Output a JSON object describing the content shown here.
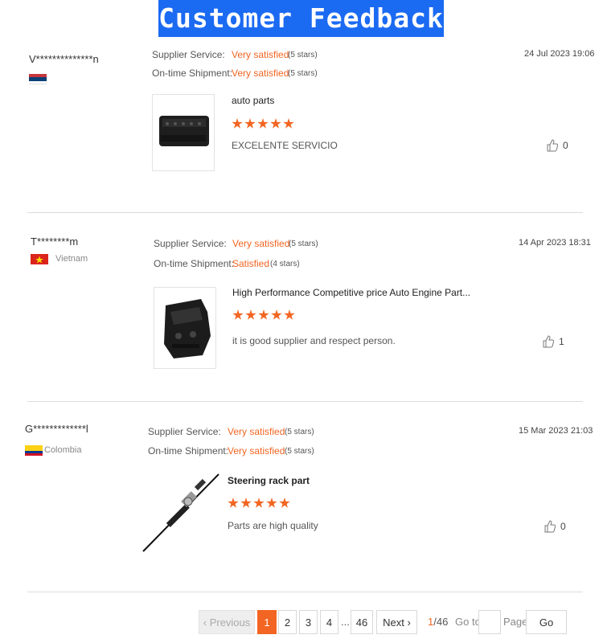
{
  "header": {
    "title": "Customer Feedback"
  },
  "labels": {
    "supplier_service": "Supplier Service:",
    "ontime_shipment": "On-time Shipment:"
  },
  "reviews": [
    {
      "user": "V**************n",
      "country": "",
      "flag": [
        "#c6363c",
        "#0c4076",
        "#ffffff"
      ],
      "supplier_rating": "Very satisfied",
      "supplier_stars": "(5 stars)",
      "shipment_rating": "Very satisfied",
      "shipment_stars": "(5 stars)",
      "date": "24 Jul 2023 19:06",
      "product": "auto parts",
      "product_stars": 5,
      "comment": "EXCELENTE SERVICIO",
      "likes": "0"
    },
    {
      "user": "T********m",
      "country": "Vietnam",
      "flag": [
        "#da251d",
        "#da251d",
        "#da251d"
      ],
      "supplier_rating": "Very satisfied",
      "supplier_stars": "(5 stars)",
      "shipment_rating": "Satisfied",
      "shipment_stars": "(4 stars)",
      "date": "14 Apr 2023 18:31",
      "product": "High Performance Competitive price Auto Engine Part...",
      "product_stars": 5,
      "comment": "it is good supplier and respect person.",
      "likes": "1"
    },
    {
      "user": "G*************l",
      "country": "Colombia",
      "flag": [
        "#fcd116",
        "#003893",
        "#ce1126"
      ],
      "supplier_rating": "Very satisfied",
      "supplier_stars": "(5 stars)",
      "shipment_rating": "Very satisfied",
      "shipment_stars": "(5 stars)",
      "date": "15 Mar 2023 21:03",
      "product": "Steering rack part",
      "product_stars": 5,
      "comment": "Parts are high quality",
      "likes": "0"
    }
  ],
  "pagination": {
    "previous": "Previous",
    "pages": [
      "1",
      "2",
      "3",
      "4",
      "...",
      "46"
    ],
    "next": "Next",
    "current": "1",
    "total": "/46",
    "goto_label": "Go to",
    "page_label": "Page",
    "go_button": "Go"
  },
  "colors": {
    "accent": "#f26522",
    "banner": "#1b6af2"
  }
}
